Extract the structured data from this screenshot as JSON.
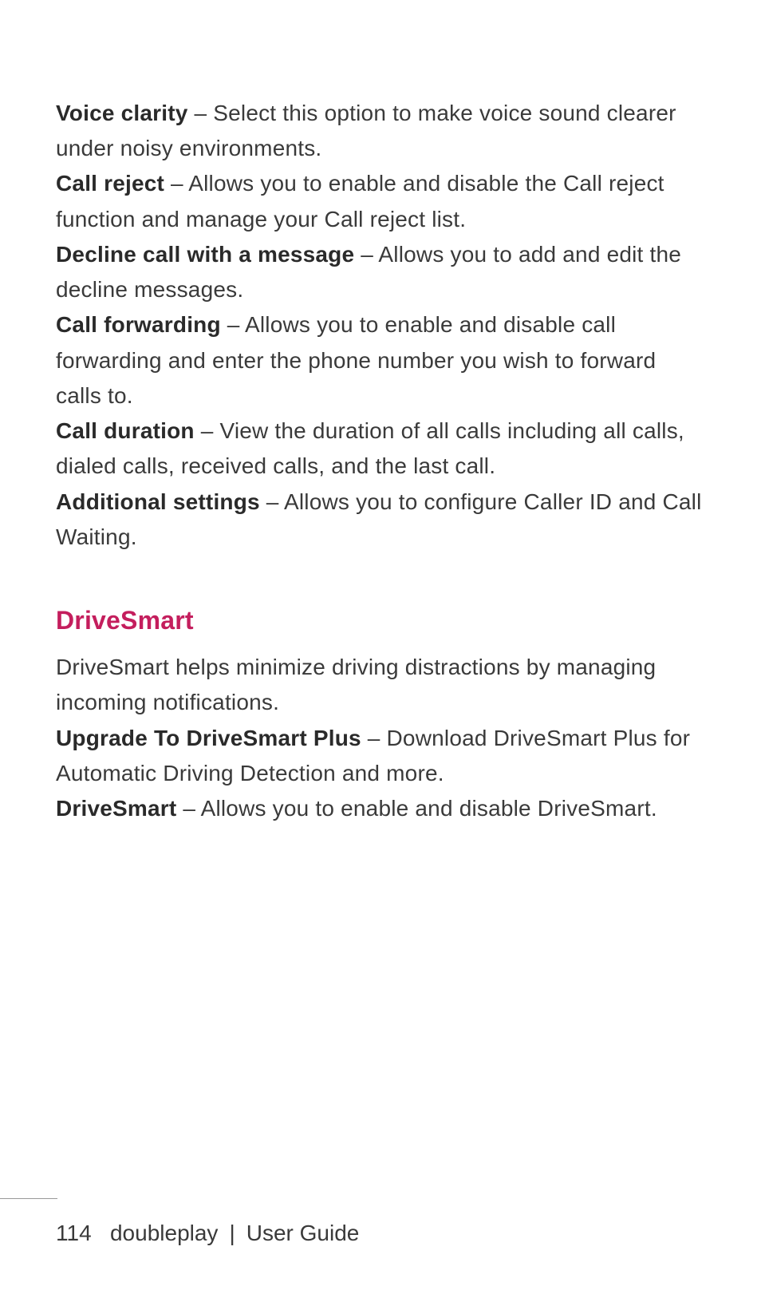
{
  "accent_color": "#c41e5d",
  "entries": [
    {
      "term": "Voice clarity",
      "desc": " – Select this option to make voice sound clearer under noisy environments."
    },
    {
      "term": "Call reject",
      "desc": " – Allows you to enable and disable the Call reject function and manage your Call reject list."
    },
    {
      "term": "Decline call with a message",
      "desc": " – Allows you to add and edit the decline messages."
    },
    {
      "term": "Call forwarding",
      "desc": " – Allows you to enable and disable call forwarding and enter the phone number you wish to forward calls to."
    },
    {
      "term": "Call duration",
      "desc": " – View the duration of all calls including all calls, dialed calls, received calls, and the last call."
    },
    {
      "term": "Additional settings",
      "desc": " – Allows you to configure Caller ID and Call Waiting."
    }
  ],
  "section": {
    "heading": "DriveSmart",
    "intro": "DriveSmart helps minimize driving distractions by managing incoming notifications.",
    "entries": [
      {
        "term": "Upgrade To DriveSmart Plus",
        "desc": " – Download DriveSmart Plus for Automatic Driving Detection and more."
      },
      {
        "term": "DriveSmart",
        "desc": " – Allows you to enable and disable DriveSmart."
      }
    ]
  },
  "footer": {
    "page_number": "114",
    "product": "doubleplay",
    "divider": "|",
    "title": "User Guide"
  }
}
